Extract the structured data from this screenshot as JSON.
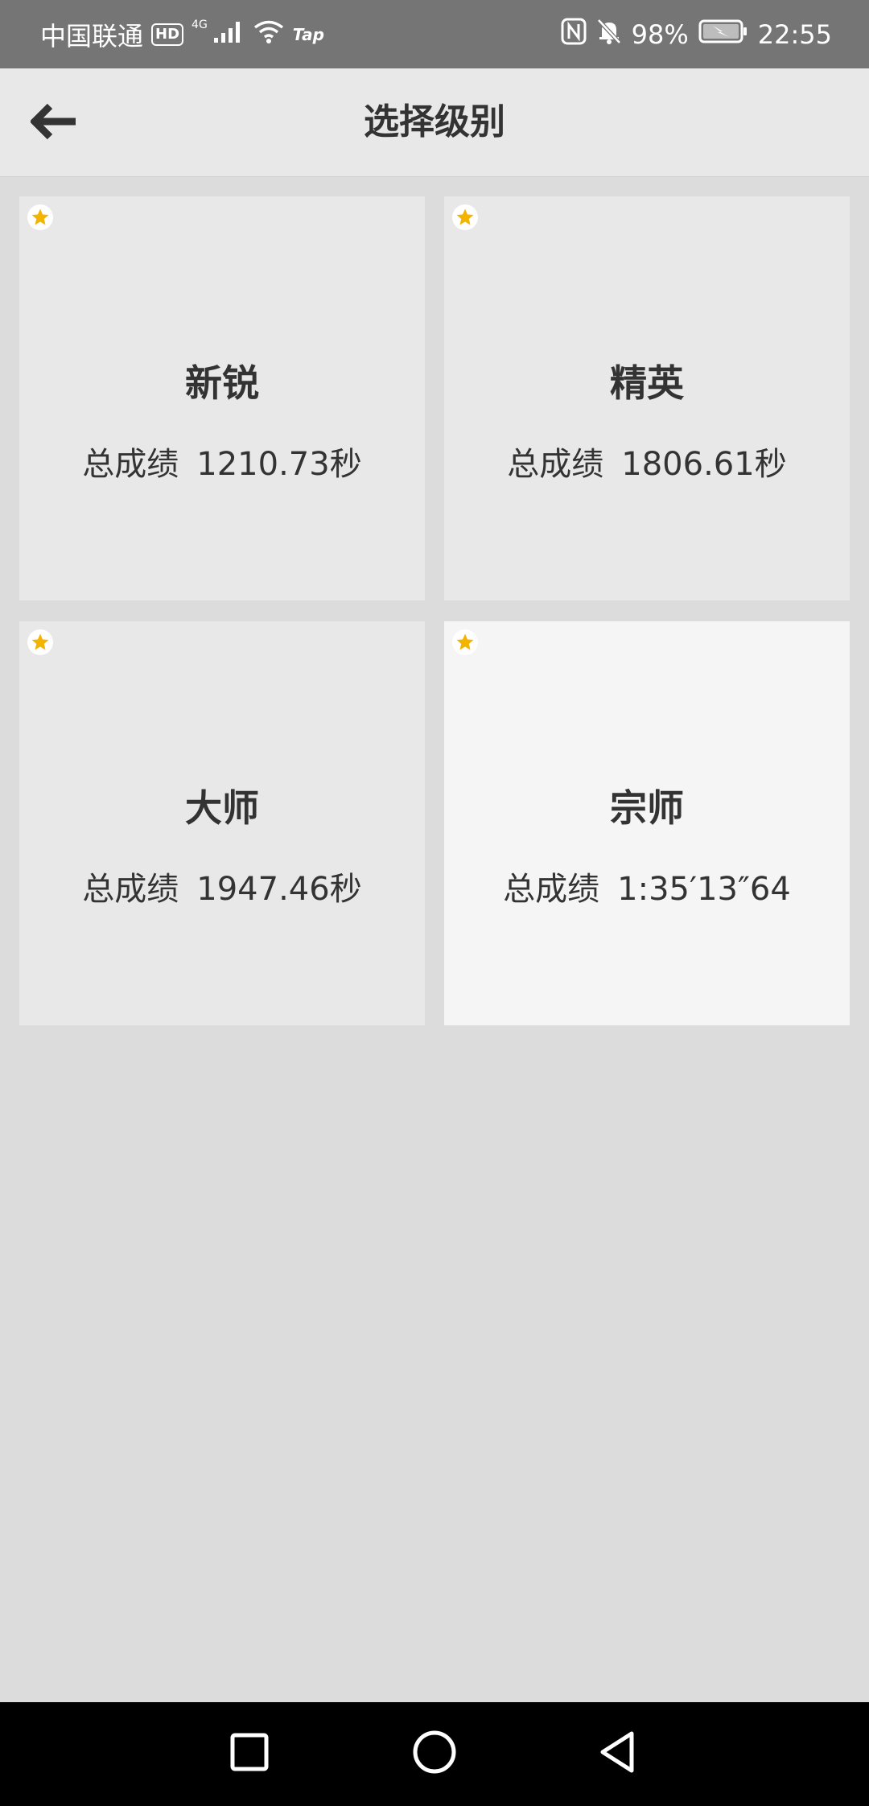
{
  "status_bar": {
    "carrier": "中国联通",
    "hd": "HD",
    "network": "4G",
    "tap": "Tap",
    "battery": "98%",
    "time": "22:55"
  },
  "app_bar": {
    "back_icon": "arrow-left-icon",
    "title": "选择级别"
  },
  "levels": [
    {
      "name": "新锐",
      "score_label": "总成绩",
      "score_value": "1210.73秒",
      "starred": true
    },
    {
      "name": "精英",
      "score_label": "总成绩",
      "score_value": "1806.61秒",
      "starred": true
    },
    {
      "name": "大师",
      "score_label": "总成绩",
      "score_value": "1947.46秒",
      "starred": true
    },
    {
      "name": "宗师",
      "score_label": "总成绩",
      "score_value": "1:35′13″64",
      "starred": true
    }
  ],
  "colors": {
    "star": "#f5b301",
    "status_bar": "#757575",
    "app_bar": "#e8e8e8",
    "background": "#dcdcdc",
    "card": "#e8e8e8",
    "card_highlight": "#f5f5f5",
    "text": "#333333"
  },
  "nav_bar": {
    "icons": [
      "recent-apps-square-icon",
      "home-circle-icon",
      "back-triangle-icon"
    ]
  }
}
